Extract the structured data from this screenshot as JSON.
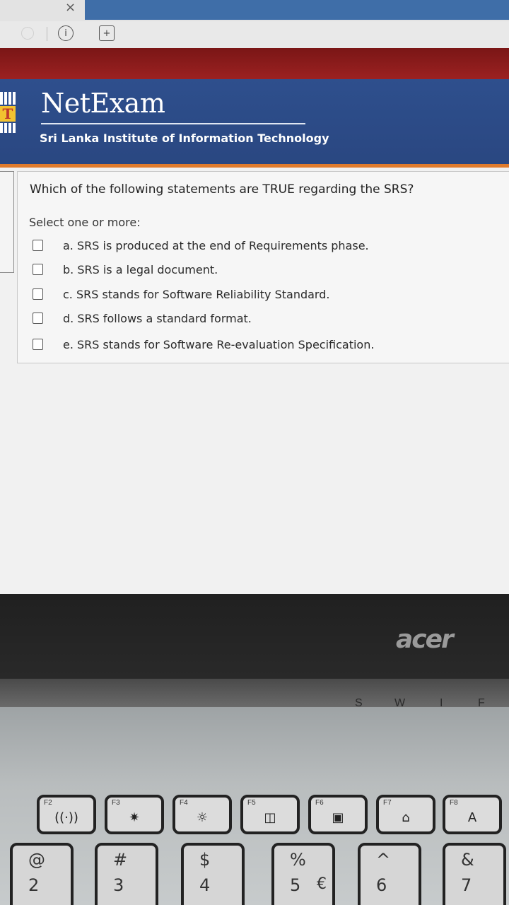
{
  "browser": {
    "tab_close": "×",
    "info_icon": "info-icon",
    "add_icon": "bookmark-add-icon"
  },
  "header": {
    "app_title": "NetExam",
    "subtitle": "Sri Lanka Institute of Information Technology"
  },
  "question": {
    "text": "Which of the following statements are TRUE regarding the SRS?",
    "instruction": "Select one or more:",
    "options": [
      {
        "label": "a. SRS is produced at the end of Requirements phase.",
        "checked": false
      },
      {
        "label": "b. SRS is a legal document.",
        "checked": false
      },
      {
        "label": "c. SRS stands for Software Reliability Standard.",
        "checked": false
      },
      {
        "label": "d. SRS follows a standard format.",
        "checked": false
      },
      {
        "label": "e. SRS stands for Software Re-evaluation Specification.",
        "checked": false
      }
    ]
  },
  "laptop": {
    "brand": "acer",
    "hinge_letters": [
      "S",
      "W",
      "I",
      "F"
    ],
    "fkeys": [
      {
        "label": "F2",
        "icon": "((·))"
      },
      {
        "label": "F3",
        "icon": "✷"
      },
      {
        "label": "F4",
        "icon": "☼"
      },
      {
        "label": "F5",
        "icon": "◫"
      },
      {
        "label": "F6",
        "icon": "▣"
      },
      {
        "label": "F7",
        "icon": "⌂"
      },
      {
        "label": "F8",
        "icon": "A"
      }
    ],
    "numkeys": [
      {
        "sym": "@",
        "num": "2",
        "alt": ""
      },
      {
        "sym": "#",
        "num": "3",
        "alt": ""
      },
      {
        "sym": "$",
        "num": "4",
        "alt": ""
      },
      {
        "sym": "%",
        "num": "5",
        "alt": "€"
      },
      {
        "sym": "^",
        "num": "6",
        "alt": ""
      },
      {
        "sym": "&",
        "num": "7",
        "alt": ""
      }
    ]
  }
}
